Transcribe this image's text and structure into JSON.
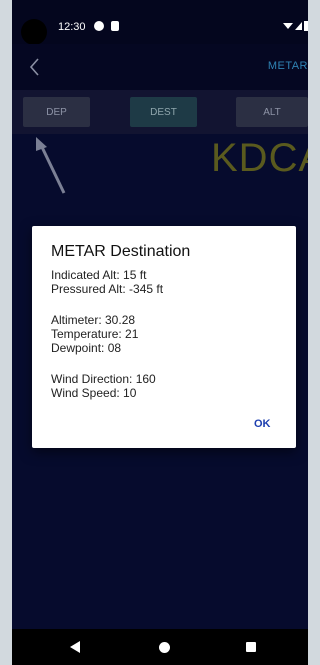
{
  "status_bar": {
    "time": "12:30"
  },
  "toolbar": {
    "title": "METAR"
  },
  "tabs": [
    {
      "label": "DEP"
    },
    {
      "label": "DEST"
    },
    {
      "label": "ALT"
    }
  ],
  "station": "KDCA",
  "dialog": {
    "title": "METAR Destination",
    "lines": [
      "Indicated Alt: 15 ft",
      "Pressured Alt: -345 ft",
      "Altimeter: 30.28",
      "Temperature: 21",
      "Dewpoint: 08",
      "Wind Direction: 160",
      "Wind Speed: 10"
    ],
    "ok_label": "OK"
  },
  "colors": {
    "background": "#060b2d",
    "accent": "#2f83b4",
    "station_text": "#5a5a1e",
    "dialog_button": "#1d3fb0"
  }
}
